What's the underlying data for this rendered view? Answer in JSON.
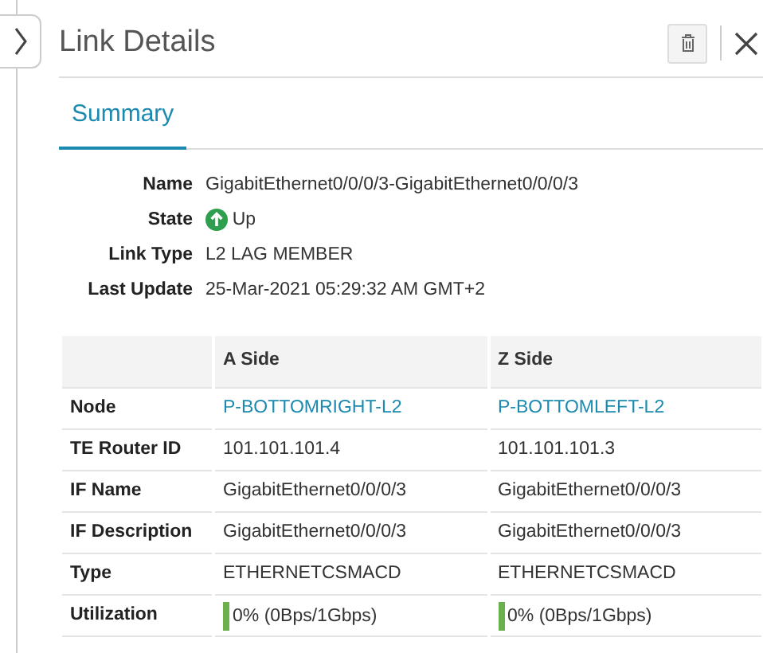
{
  "panel": {
    "title": "Link Details"
  },
  "tabs": [
    {
      "label": "Summary",
      "selected": true
    }
  ],
  "summary": [
    {
      "label": "Name",
      "value": "GigabitEthernet0/0/0/3-GigabitEthernet0/0/0/3"
    },
    {
      "label": "State",
      "value": "Up",
      "kind": "status",
      "up": true
    },
    {
      "label": "Link Type",
      "value": "L2 LAG MEMBER"
    },
    {
      "label": "Last Update",
      "value": "25-Mar-2021 05:29:32 AM GMT+2"
    }
  ],
  "table": {
    "columns": [
      "A Side",
      "Z Side"
    ],
    "rows": [
      {
        "label": "Node",
        "kind": "link",
        "cells": [
          {
            "text": "P-BOTTOMRIGHT-L2"
          },
          {
            "text": "P-BOTTOMLEFT-L2"
          }
        ]
      },
      {
        "label": "TE Router ID",
        "kind": "text",
        "cells": [
          {
            "text": "101.101.101.4"
          },
          {
            "text": "101.101.101.3"
          }
        ]
      },
      {
        "label": "IF Name",
        "kind": "text",
        "cells": [
          {
            "text": "GigabitEthernet0/0/0/3"
          },
          {
            "text": "GigabitEthernet0/0/0/3"
          }
        ]
      },
      {
        "label": "IF Description",
        "kind": "text",
        "cells": [
          {
            "text": "GigabitEthernet0/0/0/3"
          },
          {
            "text": "GigabitEthernet0/0/0/3"
          }
        ]
      },
      {
        "label": "Type",
        "kind": "text",
        "cells": [
          {
            "text": "ETHERNETCSMACD"
          },
          {
            "text": "ETHERNETCSMACD"
          }
        ]
      },
      {
        "label": "Utilization",
        "kind": "meter",
        "cells": [
          {
            "text": "0% (0Bps/1Gbps)",
            "level": 0
          },
          {
            "text": "0% (0Bps/1Gbps)",
            "level": 0
          }
        ]
      }
    ]
  }
}
